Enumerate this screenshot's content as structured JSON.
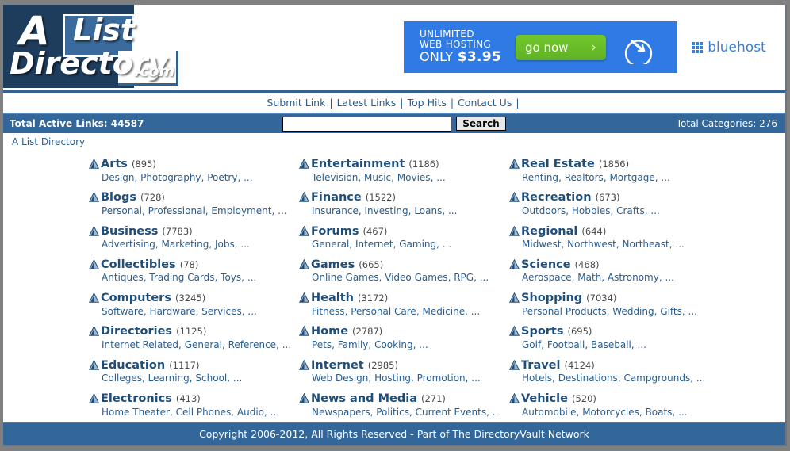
{
  "site": {
    "logo": {
      "letter_a": "A",
      "word_list": "List",
      "word_directory": "Directory",
      "word_com": ".com"
    },
    "brand_color": "#1e3c5c",
    "accent_color": "#336699"
  },
  "banner": {
    "line1": "UNLIMITED",
    "line2": "WEB HOSTING",
    "line3_prefix": "ONLY ",
    "line3_price": "$3.95",
    "cta_label": "go now",
    "cta_chevron": "›",
    "advertiser": "bluehost",
    "bg_color": "#2f7ae5",
    "cta_color": "#6abf2a"
  },
  "nav": {
    "items": [
      {
        "label": "Submit Link"
      },
      {
        "label": "Latest Links"
      },
      {
        "label": "Top Hits"
      },
      {
        "label": "Contact Us"
      }
    ],
    "separator": "|"
  },
  "stats": {
    "total_active_links": "Total Active Links: 44587",
    "total_categories": "Total Categories: 276"
  },
  "search": {
    "value": "",
    "placeholder": "",
    "button_label": "Search"
  },
  "breadcrumb": {
    "label": "A List Directory"
  },
  "categories": {
    "columns": [
      [
        {
          "name": "Arts",
          "count": "(895)",
          "subs": [
            {
              "label": "Design",
              "underlined": false
            },
            {
              "label": "Photography",
              "underlined": true
            },
            {
              "label": "Poetry",
              "underlined": false
            }
          ],
          "ellipsis": "..."
        },
        {
          "name": "Blogs",
          "count": "(728)",
          "subs": [
            {
              "label": "Personal",
              "underlined": false
            },
            {
              "label": "Professional",
              "underlined": false
            },
            {
              "label": "Employment",
              "underlined": false
            }
          ],
          "ellipsis": "..."
        },
        {
          "name": "Business",
          "count": "(7783)",
          "subs": [
            {
              "label": "Advertising",
              "underlined": false
            },
            {
              "label": "Marketing",
              "underlined": false
            },
            {
              "label": "Jobs",
              "underlined": false
            }
          ],
          "ellipsis": "..."
        },
        {
          "name": "Collectibles",
          "count": "(78)",
          "subs": [
            {
              "label": "Antiques",
              "underlined": false
            },
            {
              "label": "Trading Cards",
              "underlined": false
            },
            {
              "label": "Toys",
              "underlined": false
            }
          ],
          "ellipsis": "..."
        },
        {
          "name": "Computers",
          "count": "(3245)",
          "subs": [
            {
              "label": "Software",
              "underlined": false
            },
            {
              "label": "Hardware",
              "underlined": false
            },
            {
              "label": "Services",
              "underlined": false
            }
          ],
          "ellipsis": "..."
        },
        {
          "name": "Directories",
          "count": "(1125)",
          "subs": [
            {
              "label": "Internet Related",
              "underlined": false
            },
            {
              "label": "General",
              "underlined": false
            },
            {
              "label": "Reference",
              "underlined": false
            }
          ],
          "ellipsis": "..."
        },
        {
          "name": "Education",
          "count": "(1117)",
          "subs": [
            {
              "label": "Colleges",
              "underlined": false
            },
            {
              "label": "Learning",
              "underlined": false
            },
            {
              "label": "School",
              "underlined": false
            }
          ],
          "ellipsis": "..."
        },
        {
          "name": "Electronics",
          "count": "(413)",
          "subs": [
            {
              "label": "Home Theater",
              "underlined": false
            },
            {
              "label": "Cell Phones",
              "underlined": false
            },
            {
              "label": "Audio",
              "underlined": false
            }
          ],
          "ellipsis": "..."
        }
      ],
      [
        {
          "name": "Entertainment",
          "count": "(1186)",
          "subs": [
            {
              "label": "Television",
              "underlined": false
            },
            {
              "label": "Music",
              "underlined": false
            },
            {
              "label": "Movies",
              "underlined": false
            }
          ],
          "ellipsis": "..."
        },
        {
          "name": "Finance",
          "count": "(1522)",
          "subs": [
            {
              "label": "Insurance",
              "underlined": false
            },
            {
              "label": "Investing",
              "underlined": false
            },
            {
              "label": "Loans",
              "underlined": false
            }
          ],
          "ellipsis": "..."
        },
        {
          "name": "Forums",
          "count": "(467)",
          "subs": [
            {
              "label": "General",
              "underlined": false
            },
            {
              "label": "Internet",
              "underlined": false
            },
            {
              "label": "Gaming",
              "underlined": false
            }
          ],
          "ellipsis": "..."
        },
        {
          "name": "Games",
          "count": "(665)",
          "subs": [
            {
              "label": "Online Games",
              "underlined": false
            },
            {
              "label": "Video Games",
              "underlined": false
            },
            {
              "label": "RPG",
              "underlined": false
            }
          ],
          "ellipsis": "..."
        },
        {
          "name": "Health",
          "count": "(3172)",
          "subs": [
            {
              "label": "Fitness",
              "underlined": false
            },
            {
              "label": "Personal Care",
              "underlined": false
            },
            {
              "label": "Medicine",
              "underlined": false
            }
          ],
          "ellipsis": "..."
        },
        {
          "name": "Home",
          "count": "(2787)",
          "subs": [
            {
              "label": "Pets",
              "underlined": false
            },
            {
              "label": "Family",
              "underlined": false
            },
            {
              "label": "Cooking",
              "underlined": false
            }
          ],
          "ellipsis": "..."
        },
        {
          "name": "Internet",
          "count": "(2985)",
          "subs": [
            {
              "label": "Web Design",
              "underlined": false
            },
            {
              "label": "Hosting",
              "underlined": false
            },
            {
              "label": "Promotion",
              "underlined": false
            }
          ],
          "ellipsis": "..."
        },
        {
          "name": "News and Media",
          "count": "(271)",
          "subs": [
            {
              "label": "Newspapers",
              "underlined": false
            },
            {
              "label": "Politics",
              "underlined": false
            },
            {
              "label": "Current Events",
              "underlined": false
            }
          ],
          "ellipsis": "..."
        }
      ],
      [
        {
          "name": "Real Estate",
          "count": "(1856)",
          "subs": [
            {
              "label": "Renting",
              "underlined": false
            },
            {
              "label": "Realtors",
              "underlined": false
            },
            {
              "label": "Mortgage",
              "underlined": false
            }
          ],
          "ellipsis": "..."
        },
        {
          "name": "Recreation",
          "count": "(673)",
          "subs": [
            {
              "label": "Outdoors",
              "underlined": false
            },
            {
              "label": "Hobbies",
              "underlined": false
            },
            {
              "label": "Crafts",
              "underlined": false
            }
          ],
          "ellipsis": "..."
        },
        {
          "name": "Regional",
          "count": "(644)",
          "subs": [
            {
              "label": "Midwest",
              "underlined": false
            },
            {
              "label": "Northwest",
              "underlined": false
            },
            {
              "label": "Northeast",
              "underlined": false
            }
          ],
          "ellipsis": "..."
        },
        {
          "name": "Science",
          "count": "(468)",
          "subs": [
            {
              "label": "Aerospace",
              "underlined": false
            },
            {
              "label": "Math",
              "underlined": false
            },
            {
              "label": "Astronomy",
              "underlined": false
            }
          ],
          "ellipsis": "..."
        },
        {
          "name": "Shopping",
          "count": "(7034)",
          "subs": [
            {
              "label": "Personal Products",
              "underlined": false
            },
            {
              "label": "Wedding",
              "underlined": false
            },
            {
              "label": "Gifts",
              "underlined": false
            }
          ],
          "ellipsis": "..."
        },
        {
          "name": "Sports",
          "count": "(695)",
          "subs": [
            {
              "label": "Golf",
              "underlined": false
            },
            {
              "label": "Football",
              "underlined": false
            },
            {
              "label": "Baseball",
              "underlined": false
            }
          ],
          "ellipsis": "..."
        },
        {
          "name": "Travel",
          "count": "(4124)",
          "subs": [
            {
              "label": "Hotels",
              "underlined": false
            },
            {
              "label": "Destinations",
              "underlined": false
            },
            {
              "label": "Campgrounds",
              "underlined": false
            }
          ],
          "ellipsis": "..."
        },
        {
          "name": "Vehicle",
          "count": "(520)",
          "subs": [
            {
              "label": "Automobile",
              "underlined": false
            },
            {
              "label": "Motorcycles",
              "underlined": false
            },
            {
              "label": "Boats",
              "underlined": false
            }
          ],
          "ellipsis": "..."
        }
      ]
    ]
  },
  "footer": {
    "text": "Copyright 2006-2012, All Rights Reserved - Part of The DirectoryVault Network"
  }
}
